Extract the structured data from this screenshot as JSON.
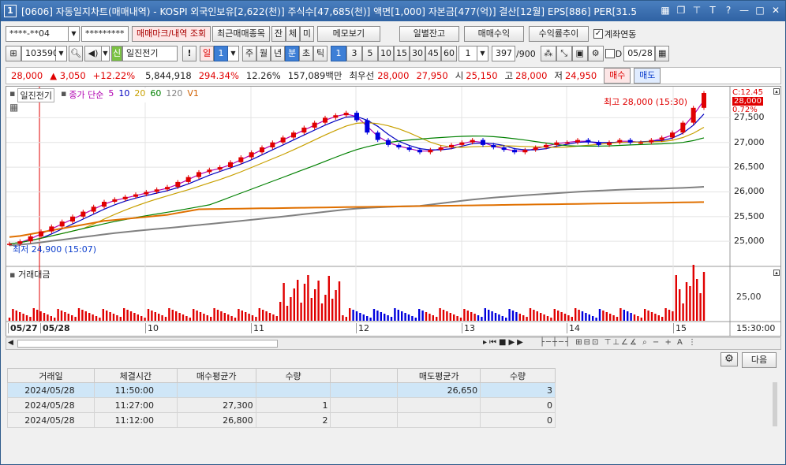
{
  "titlebar": {
    "num": "1",
    "text": "[0606] 자동일지차트(매매내역) - KOSPI 외국인보유[2,622(천)] 주식수[47,685(천)] 액면[1,000] 자본금[477(억)] 결산[12월] EPS[886] PER[31.5",
    "icons": [
      "grid-icon",
      "window-icon",
      "pin-icon",
      "font-icon",
      "help-icon",
      "minimize-icon",
      "maximize-icon",
      "close-icon"
    ]
  },
  "toolbar1": {
    "account": "****-**04",
    "password": "*********",
    "trade_mark_btn": "매매마크/내역 조회",
    "recent_trades_btn": "최근매매종목",
    "jan_btn": "잔",
    "che_btn": "체",
    "mi_btn": "미",
    "memo_btn": "메모보기",
    "daily_balance_btn": "일별잔고",
    "trade_profit_btn": "매매수익",
    "return_trend_btn": "수익률추이",
    "account_link_label": "계좌연동",
    "account_link_checked": true
  },
  "toolbar2": {
    "code": "103590",
    "stock_name": "일진전기",
    "badge": "신",
    "excl": "!",
    "period_sel": "일",
    "period_num": "1",
    "week": "주",
    "month": "월",
    "year": "년",
    "minute": "분",
    "second": "초",
    "tick": "틱",
    "intervals": [
      "1",
      "3",
      "5",
      "10",
      "15",
      "30",
      "45",
      "60"
    ],
    "interval_selected": "1",
    "count_num": "1",
    "count": "397",
    "total": "/900",
    "date": "05/28",
    "d_label": "D"
  },
  "quote": {
    "price": "28,000",
    "change": "▲ 3,050",
    "pct": "+12.22%",
    "volume": "5,844,918",
    "vol_ratio": "294.34%",
    "turnover": "12.26%",
    "amount": "157,089백만",
    "best_label": "최우선",
    "ask": "28,000",
    "bid": "27,950",
    "open_label": "시",
    "open": "25,150",
    "high_label": "고",
    "high": "28,000",
    "low_label": "저",
    "low": "24,950",
    "buy_btn": "매수",
    "sell_btn": "매도"
  },
  "chart_panel": {
    "legend_name": "일진전기",
    "legend_items": [
      {
        "label": "종가 단순",
        "color": "#b000b0"
      },
      {
        "label": "5",
        "color": "#b000b0"
      },
      {
        "label": "10",
        "color": "#0000c0"
      },
      {
        "label": "20",
        "color": "#c8a000"
      },
      {
        "label": "60",
        "color": "#008000"
      },
      {
        "label": "120",
        "color": "#808080"
      },
      {
        "label": "V1",
        "color": "#d06000"
      }
    ],
    "top_right_labels": [
      "C:12.45",
      "28,000",
      "0.72%"
    ],
    "max_label": "최고 28,000 (15:30)",
    "min_label": "최저 24,900 (15:07)",
    "y_ticks": [
      "27,500",
      "27,000",
      "26,500",
      "26,000",
      "25,500",
      "25,000"
    ],
    "volume_title": "거래대금",
    "volume_tick": "25,00",
    "x_labels": [
      "05/27",
      "05/28",
      "10",
      "11",
      "12",
      "13",
      "14",
      "15"
    ],
    "time_label": "15:30:00",
    "accent_red": "#e00000",
    "accent_blue": "#0000dd"
  },
  "chart_data": {
    "type": "candlestick",
    "ylim": [
      24700,
      28000
    ],
    "price_series": [
      24950,
      25000,
      25100,
      25200,
      25300,
      25400,
      25500,
      25600,
      25700,
      25800,
      25850,
      25900,
      25950,
      26000,
      26050,
      26100,
      26200,
      26300,
      26400,
      26450,
      26500,
      26600,
      26700,
      26800,
      26900,
      27000,
      27100,
      27200,
      27300,
      27400,
      27500,
      27550,
      27600,
      27450,
      27200,
      27050,
      26950,
      26900,
      26850,
      26800,
      26850,
      26900,
      26950,
      27000,
      27050,
      26950,
      26900,
      26850,
      26800,
      26850,
      26900,
      26950,
      27000,
      27000,
      27050,
      27000,
      26950,
      27000,
      27050,
      27000,
      27000,
      27050,
      27100,
      27200,
      27400,
      27700,
      28000
    ],
    "ma_series": [
      {
        "name": "5",
        "color": "#b000b0"
      },
      {
        "name": "10",
        "color": "#0000c0"
      },
      {
        "name": "20",
        "color": "#c8a000"
      },
      {
        "name": "60",
        "color": "#008000"
      },
      {
        "name": "120",
        "color": "#808080"
      }
    ]
  },
  "scrollbar": {
    "label": "scroll"
  },
  "table": {
    "settings_icon": "gear-icon",
    "next_btn": "다음",
    "headers": [
      "거래일",
      "체결시간",
      "매수평균가",
      "수량",
      "",
      "매도평균가",
      "수량"
    ],
    "rows": [
      {
        "date": "2024/05/28",
        "time": "11:50:00",
        "buy_avg": "",
        "buy_qty": "",
        "blank": "",
        "sell_avg": "26,650",
        "sell_qty": "3"
      },
      {
        "date": "2024/05/28",
        "time": "11:27:00",
        "buy_avg": "27,300",
        "buy_qty": "1",
        "blank": "",
        "sell_avg": "",
        "sell_qty": "0"
      },
      {
        "date": "2024/05/28",
        "time": "11:12:00",
        "buy_avg": "26,800",
        "buy_qty": "2",
        "blank": "",
        "sell_avg": "",
        "sell_qty": "0"
      }
    ]
  }
}
